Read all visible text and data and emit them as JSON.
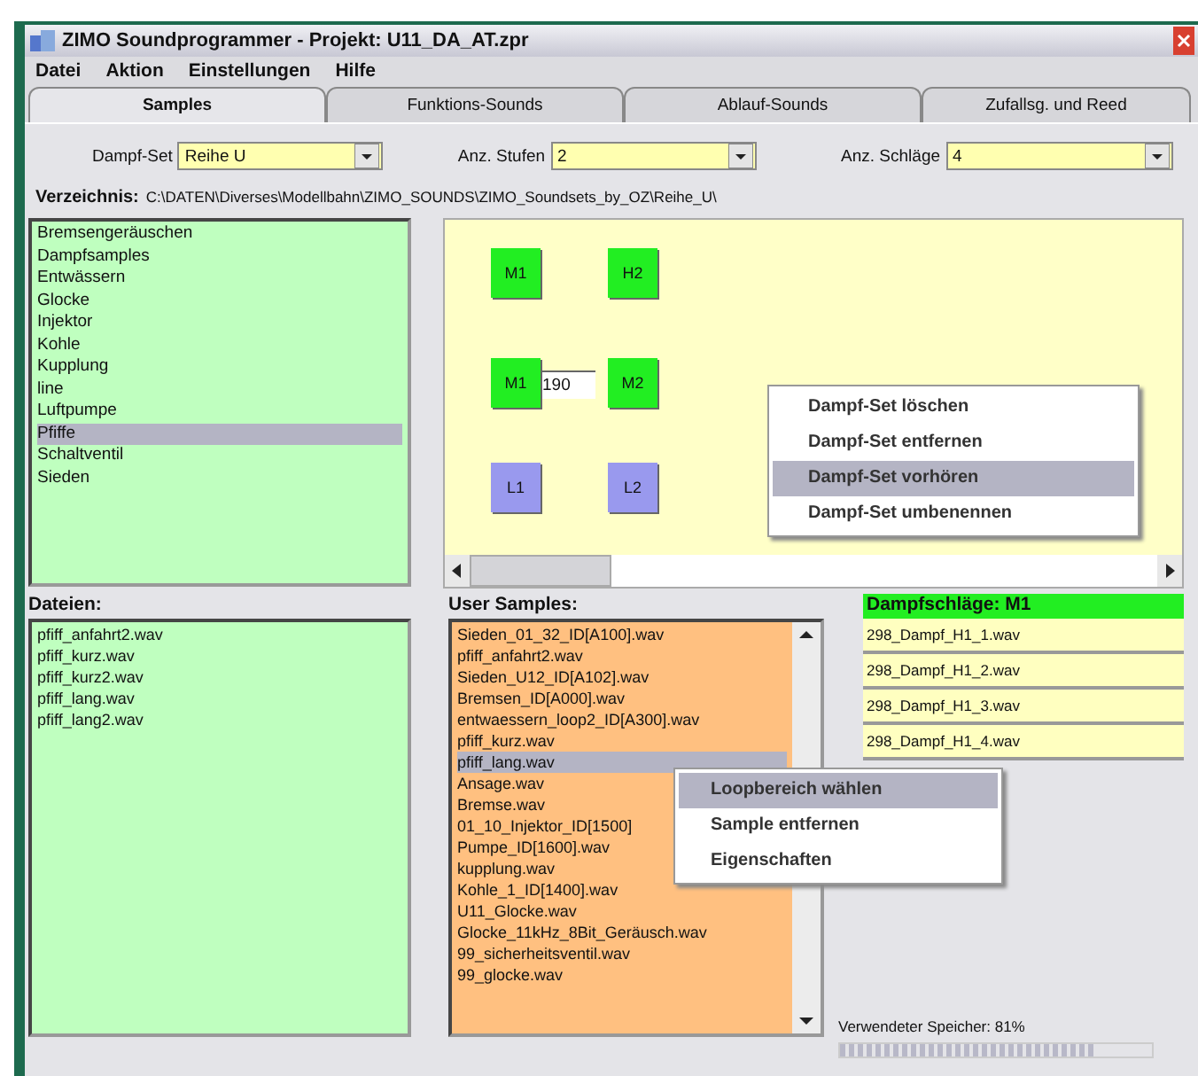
{
  "window": {
    "title": "ZIMO Soundprogrammer - Projekt: U11_DA_AT.zpr"
  },
  "menu": [
    "Datei",
    "Aktion",
    "Einstellungen",
    "Hilfe"
  ],
  "tabs": [
    {
      "label": "Samples",
      "selected": true
    },
    {
      "label": "Funktions-Sounds",
      "selected": false
    },
    {
      "label": "Ablauf-Sounds",
      "selected": false
    },
    {
      "label": "Zufallsg. und Reed",
      "selected": false
    }
  ],
  "fields": [
    {
      "label": "Dampf-Set",
      "value": "Reihe U"
    },
    {
      "label": "Anz. Stufen",
      "value": "2"
    },
    {
      "label": "Anz. Schläge",
      "value": "4"
    }
  ],
  "directory": {
    "label": "Verzeichnis:",
    "path": "C:\\DATEN\\Diverses\\Modellbahn\\ZIMO_SOUNDS\\ZIMO_Soundsets_by_OZ\\Reihe_U\\"
  },
  "categories": [
    {
      "label": "Bremsengeräuschen",
      "selected": false
    },
    {
      "label": "Dampfsamples",
      "selected": false
    },
    {
      "label": "Entwässern",
      "selected": false
    },
    {
      "label": "Glocke",
      "selected": false
    },
    {
      "label": "Injektor",
      "selected": false
    },
    {
      "label": "Kohle",
      "selected": false
    },
    {
      "label": "Kupplung",
      "selected": false
    },
    {
      "label": "line",
      "selected": false
    },
    {
      "label": "Luftpumpe",
      "selected": false
    },
    {
      "label": "Pfiffe",
      "selected": true
    },
    {
      "label": "Schaltventil",
      "selected": false
    },
    {
      "label": "Sieden",
      "selected": false
    }
  ],
  "canvas": {
    "blocks": [
      {
        "label": "M1",
        "color": "#22ee22"
      },
      {
        "label": "H2",
        "color": "#22ee22"
      },
      {
        "label": "M1",
        "color": "#22ee22"
      },
      {
        "label": "M2",
        "color": "#22ee22"
      },
      {
        "label": "L1",
        "color": "#9999ee"
      },
      {
        "label": "L2",
        "color": "#9999ee"
      }
    ],
    "link_value": "190",
    "context_menu": [
      {
        "label": "Dampf-Set löschen",
        "selected": false
      },
      {
        "label": "Dampf-Set entfernen",
        "selected": false
      },
      {
        "label": "Dampf-Set vorhören",
        "selected": true
      },
      {
        "label": "Dampf-Set umbenennen",
        "selected": false
      }
    ]
  },
  "files": {
    "label": "Dateien:",
    "items": [
      "pfiff_anfahrt2.wav",
      "pfiff_kurz.wav",
      "pfiff_kurz2.wav",
      "pfiff_lang.wav",
      "pfiff_lang2.wav"
    ]
  },
  "user_samples": {
    "label": "User Samples:",
    "items": [
      {
        "label": "Sieden_01_32_ID[A100].wav",
        "selected": false
      },
      {
        "label": "pfiff_anfahrt2.wav",
        "selected": false
      },
      {
        "label": "Sieden_U12_ID[A102].wav",
        "selected": false
      },
      {
        "label": "Bremsen_ID[A000].wav",
        "selected": false
      },
      {
        "label": "entwaessern_loop2_ID[A300].wav",
        "selected": false
      },
      {
        "label": "pfiff_kurz.wav",
        "selected": false
      },
      {
        "label": "pfiff_lang.wav",
        "selected": true
      },
      {
        "label": "Ansage.wav",
        "selected": false
      },
      {
        "label": "Bremse.wav",
        "selected": false
      },
      {
        "label": "01_10_Injektor_ID[1500]",
        "selected": false
      },
      {
        "label": "Pumpe_ID[1600].wav",
        "selected": false
      },
      {
        "label": "kupplung.wav",
        "selected": false
      },
      {
        "label": "Kohle_1_ID[1400].wav",
        "selected": false
      },
      {
        "label": "U11_Glocke.wav",
        "selected": false
      },
      {
        "label": "Glocke_11kHz_8Bit_Geräusch.wav",
        "selected": false
      },
      {
        "label": "99_sicherheitsventil.wav",
        "selected": false
      },
      {
        "label": "99_glocke.wav",
        "selected": false
      }
    ],
    "context_menu": [
      {
        "label": "Loopbereich wählen",
        "selected": true
      },
      {
        "label": "Sample entfernen",
        "selected": false
      },
      {
        "label": "Eigenschaften",
        "selected": false
      }
    ]
  },
  "steam_beats": {
    "header": "Dampfschläge: M1",
    "items": [
      "298_Dampf_H1_1.wav",
      "298_Dampf_H1_2.wav",
      "298_Dampf_H1_3.wav",
      "298_Dampf_H1_4.wav"
    ]
  },
  "memory": {
    "label": "Verwendeter Speicher: 81%",
    "level": 0.81
  }
}
